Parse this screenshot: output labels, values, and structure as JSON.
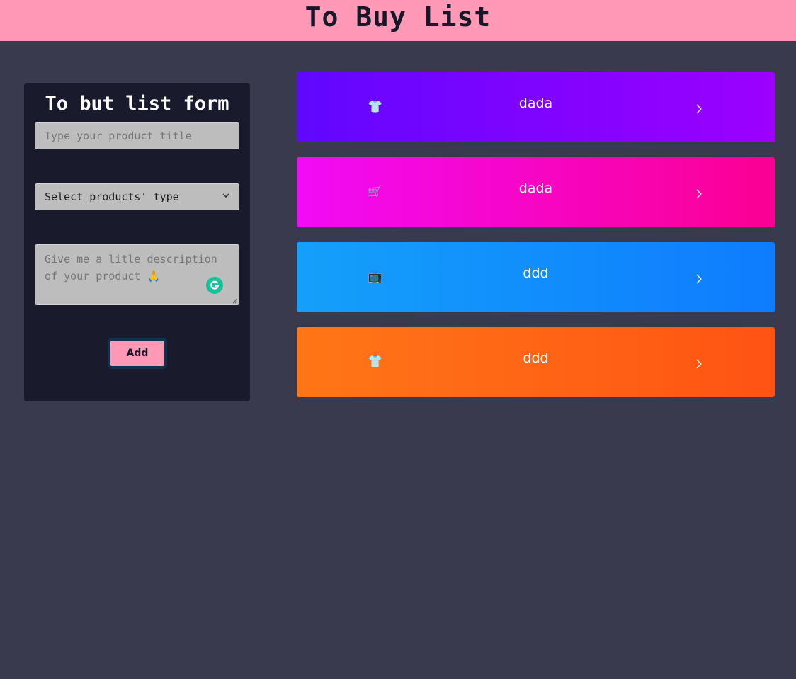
{
  "header": {
    "title": "To Buy List"
  },
  "form": {
    "title": "To but list form",
    "title_placeholder": "Type your product title",
    "type_select_value": "Select products' type",
    "description_placeholder": "Give me a litle description of your product 🙏",
    "add_label": "Add"
  },
  "items": [
    {
      "title": "dada",
      "icon": "tshirt-icon",
      "glyph": "👕",
      "gradient": [
        "#6107ff",
        "#9c00ff"
      ]
    },
    {
      "title": "dada",
      "icon": "shopping-cart-icon",
      "glyph": "🛒",
      "gradient": [
        "#f20bf6",
        "#fb0092"
      ]
    },
    {
      "title": "ddd",
      "icon": "television-icon",
      "glyph": "📺",
      "gradient": [
        "#14a0fa",
        "#0e7cfe"
      ]
    },
    {
      "title": "ddd",
      "icon": "tshirt-icon",
      "glyph": "👕",
      "gradient": [
        "#ff7716",
        "#ff5314"
      ]
    }
  ],
  "colors": {
    "header_bg": "#ff99b5",
    "page_bg": "#393a4e",
    "panel_bg": "#191b2c",
    "grammarly": "#15c39a"
  }
}
